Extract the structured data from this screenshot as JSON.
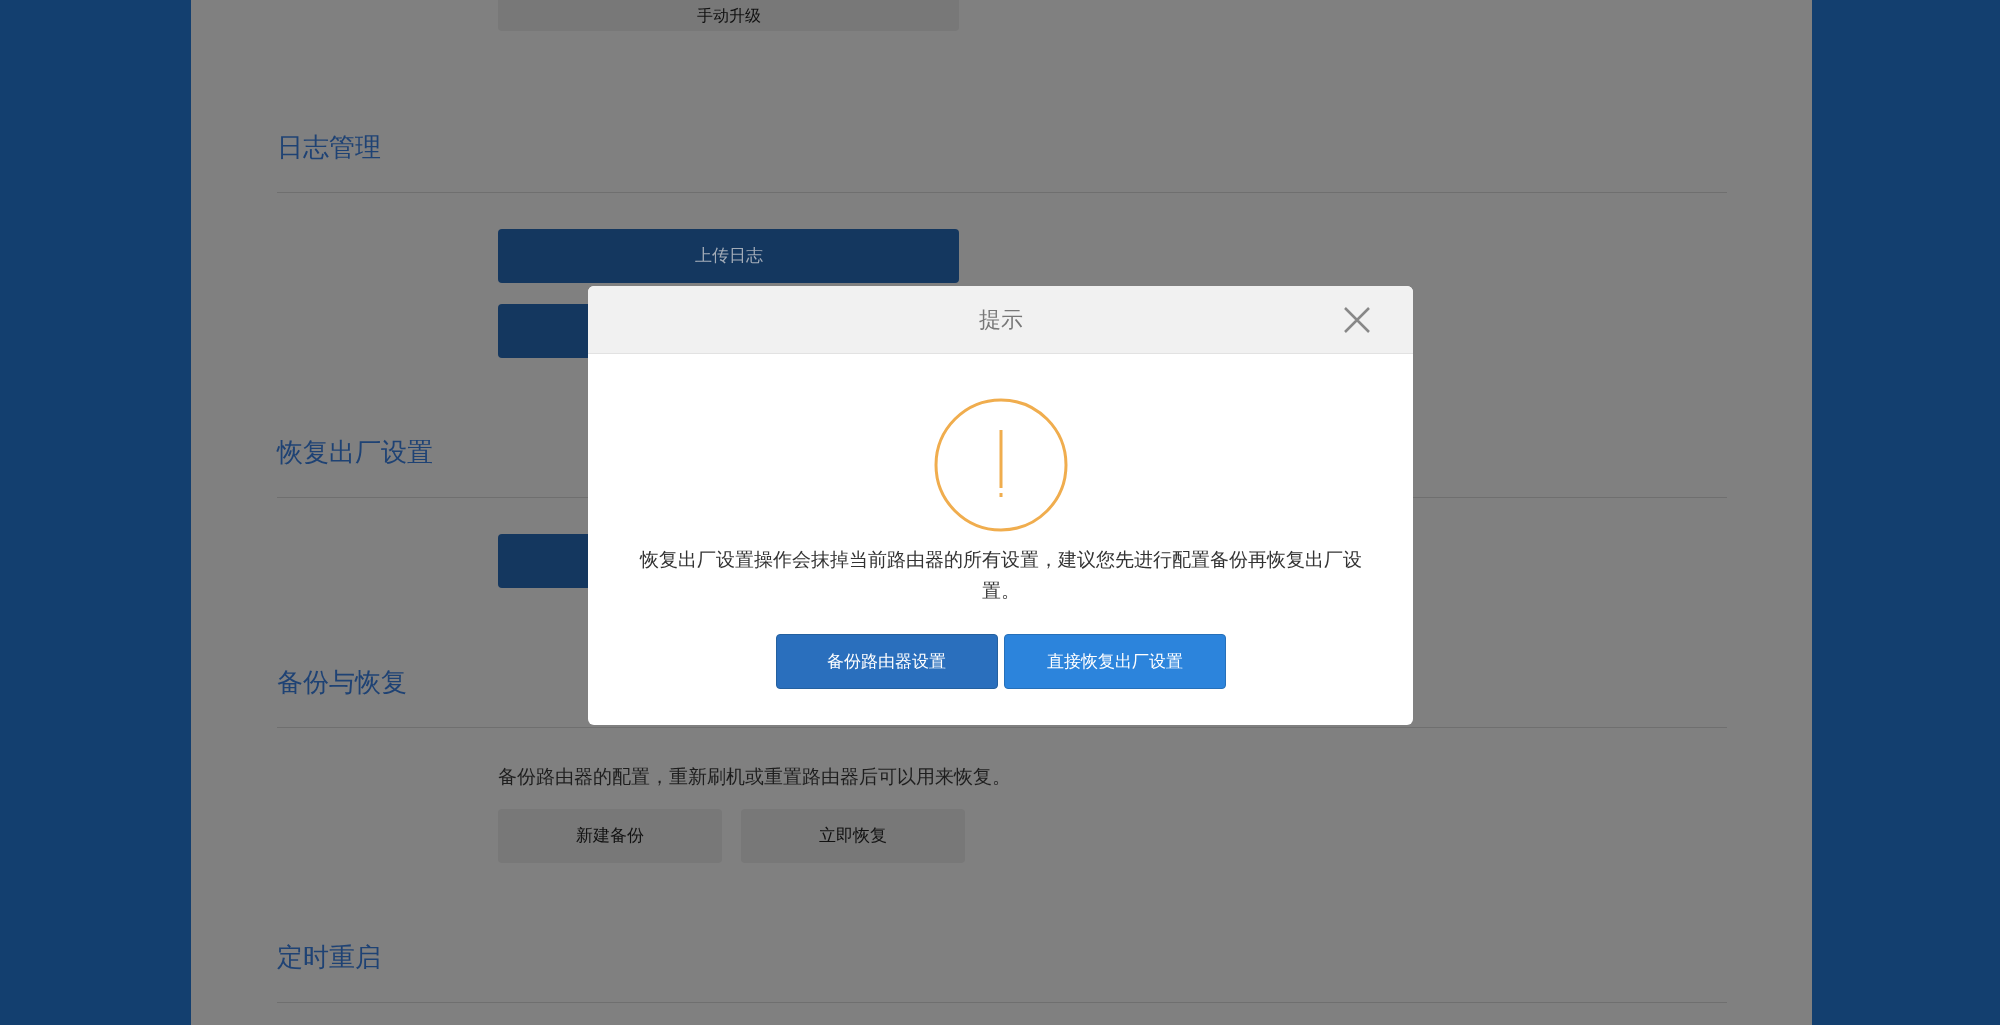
{
  "top_button": {
    "label": "手动升级"
  },
  "sections": [
    {
      "title": "日志管理",
      "items": [
        {
          "kind": "primary_button",
          "label": "上传日志"
        },
        {
          "kind": "primary_button"
        }
      ]
    },
    {
      "title": "恢复出厂设置",
      "items": [
        {
          "kind": "primary_button"
        }
      ]
    },
    {
      "title": "备份与恢复",
      "items": [
        {
          "kind": "text",
          "text": "备份路由器的配置，重新刷机或重置路由器后可以用来恢复。"
        },
        {
          "kind": "button_row",
          "buttons": [
            "新建备份",
            "立即恢复"
          ]
        }
      ]
    },
    {
      "title": "定时重启"
    }
  ],
  "dialog": {
    "title": "提示",
    "message": "恢复出厂设置操作会抹掉当前路由器的所有设置，建议您先进行配置备份再恢复出厂设置。",
    "buttons": [
      {
        "label": "备份路由器设置",
        "kind": "secondary"
      },
      {
        "label": "直接恢复出厂设置",
        "kind": "primary"
      }
    ]
  }
}
